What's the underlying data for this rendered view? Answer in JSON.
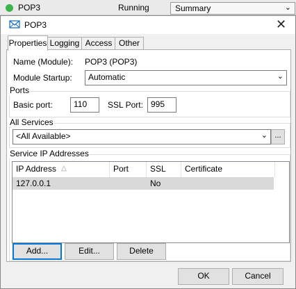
{
  "topbar": {
    "module_name": "POP3",
    "status": "Running",
    "view_select": "Summary"
  },
  "dialog": {
    "title": "POP3",
    "tabs": [
      "Properties",
      "Logging",
      "Access",
      "Other"
    ],
    "properties": {
      "name_label": "Name (Module):",
      "name_value": "POP3 (POP3)",
      "startup_label": "Module Startup:",
      "startup_value": "Automatic",
      "ports_group": "Ports",
      "basic_port_label": "Basic port:",
      "basic_port_value": "110",
      "ssl_port_label": "SSL Port:",
      "ssl_port_value": "995",
      "services_group": "All Services",
      "services_value": "<All Available>",
      "services_browse": "...",
      "ip_group": "Service IP Addresses",
      "columns": [
        "IP Address",
        "Port",
        "SSL",
        "Certificate"
      ],
      "rows": [
        {
          "ip": "127.0.0.1",
          "port": "",
          "ssl": "No",
          "certificate": ""
        }
      ],
      "add_label": "Add...",
      "edit_label": "Edit...",
      "delete_label": "Delete"
    },
    "ok_label": "OK",
    "cancel_label": "Cancel"
  },
  "colors": {
    "status_dot": "#3cb44a",
    "selected_row": "#d9d9d9",
    "default_button_border": "#0078d7"
  }
}
